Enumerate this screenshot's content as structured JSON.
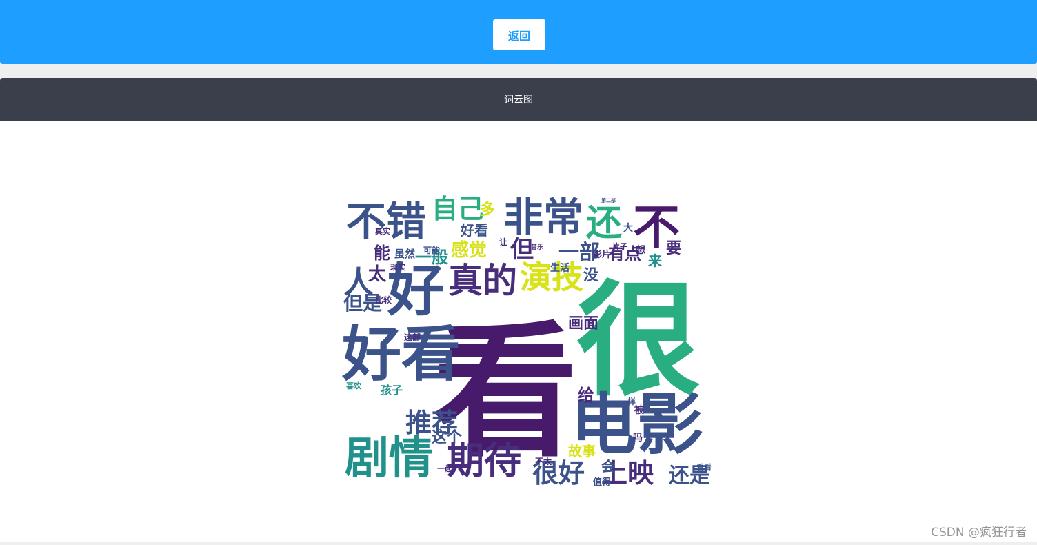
{
  "header": {
    "back_label": "返回"
  },
  "panel": {
    "title": "词云图"
  },
  "watermark": "CSDN @疯狂行者",
  "colors": {
    "accent": "#1e9fff",
    "panel_header": "#3a3f4b",
    "wc_dark_purple": "#481a6c",
    "wc_purple": "#472d7b",
    "wc_blue": "#3b528b",
    "wc_teal_blue": "#2c728e",
    "wc_teal": "#21918c",
    "wc_green": "#28ae80",
    "wc_light_green": "#5ec962",
    "wc_yellow_green": "#addc30",
    "wc_yellow": "#d8e219"
  },
  "wordcloud": {
    "words": [
      "看",
      "很",
      "好",
      "电影",
      "不错",
      "非常",
      "还",
      "不",
      "剧情",
      "期待",
      "好看",
      "真的",
      "演技",
      "人",
      "太",
      "自己",
      "推荐",
      "上映",
      "还是",
      "但是",
      "画面",
      "一部",
      "感觉",
      "一般",
      "故事",
      "有点",
      "这个",
      "但",
      "没",
      "来",
      "给",
      "会",
      "能",
      "喜欢",
      "值得",
      "这部",
      "生活",
      "孩子",
      "影片",
      "虽然",
      "可能",
      "多",
      "要",
      "想",
      "大",
      "被",
      "吗",
      "一样",
      "比较",
      "现实",
      "第二部",
      "片子",
      "让",
      "音乐",
      "一起",
      "好看",
      "很好",
      "看看",
      "真实",
      "不太"
    ]
  }
}
